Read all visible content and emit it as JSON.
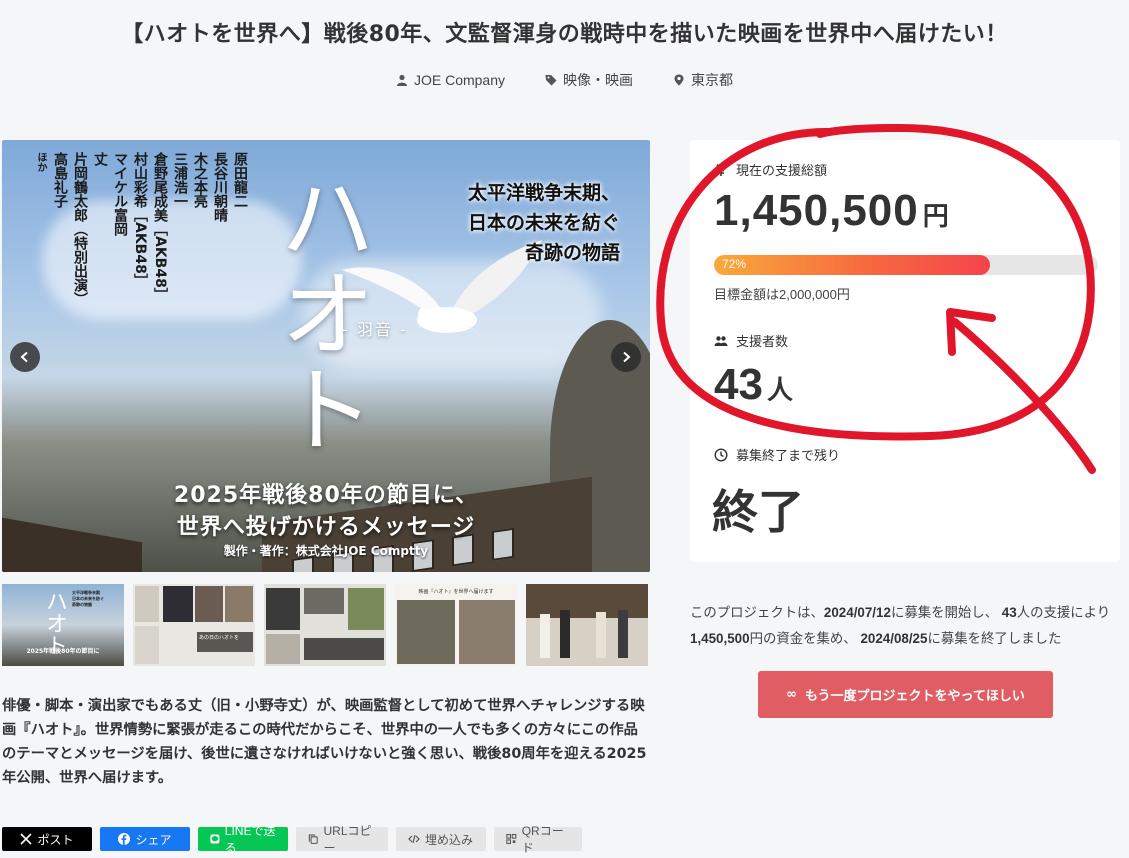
{
  "page": {
    "title": "【ハオトを世界へ】戦後80年、文監督渾身の戦時中を描いた映画を世界中へ届けたい！"
  },
  "meta": {
    "owner": "JOE Company",
    "category": "映像・映画",
    "location": "東京都"
  },
  "hero": {
    "cast": [
      "原田龍二",
      "長谷川朝晴",
      "木之本亮",
      "三浦浩一",
      "倉野尾成美［AKB48］",
      "村山彩希［AKB48］",
      "マイケル富岡",
      "丈",
      "片岡鶴太郎（特別出演）",
      "高島礼子",
      "ほか"
    ],
    "title_main": "ハオト",
    "title_sub": "- 羽音 -",
    "tagline": [
      "太平洋戦争末期、",
      "日本の未来を紡ぐ",
      "奇跡の物語"
    ],
    "message": [
      "2025年戦後80年の節目に、",
      "世界へ投げかけるメッセージ"
    ],
    "credit": "製作・著作：株式会社JOE Comptty"
  },
  "thumb1": {
    "lines": [
      "太平洋戦争末期",
      "日本の未来を紡ぐ",
      "奇跡の物語"
    ],
    "title": "ハオト",
    "caption": "2025年戦後80年の節目に"
  },
  "thumb2": {
    "caption": "あの日のハオトを"
  },
  "thumb4": {
    "caption": "映画『ハオト』を世界へ届けます"
  },
  "description": "俳優・脚本・演出家でもある丈（旧・小野寺丈）が、映画監督として初めて世界へチャレンジする映画『ハオト』。世界情勢に緊張が走るこの時代だからこそ、世界中の一人でも多くの方々にこの作品のテーマとメッセージを届け、後世に遺さなければいけないと強く思い、戦後80周年を迎える2025年公開、世界へ届けます。",
  "share": {
    "x": "ポスト",
    "facebook": "シェア",
    "line": "LINEで送る",
    "url_copy": "URLコピー",
    "embed": "埋め込み",
    "qr": "QRコード"
  },
  "stats": {
    "total_label": "現在の支援総額",
    "total_amount": "1,450,500",
    "total_unit": "円",
    "progress_text": "72%",
    "progress_ratio": 0.72,
    "goal_text": "目標金額は2,000,000円",
    "backers_label": "支援者数",
    "backers_count": "43",
    "backers_unit": "人",
    "remaining_label": "募集終了まで残り",
    "remaining_value": "終了"
  },
  "summary": {
    "p1": "このプロジェクトは、",
    "start_date": "2024/07/12",
    "p2": "に募集を開始し、 ",
    "backers": "43",
    "p3": "人の支援により ",
    "amount": "1,450,500",
    "p4": "円の資金を集め、 ",
    "end_date": "2024/08/25",
    "p5": "に募集を終了しました"
  },
  "again_button": {
    "icon": "∞",
    "label": "もう一度プロジェクトをやってほしい"
  },
  "colors": {
    "annotation_red": "#e0172b",
    "again_button": "#e05d64",
    "progress_start": "#f9a93c",
    "progress_end": "#f5444c"
  }
}
